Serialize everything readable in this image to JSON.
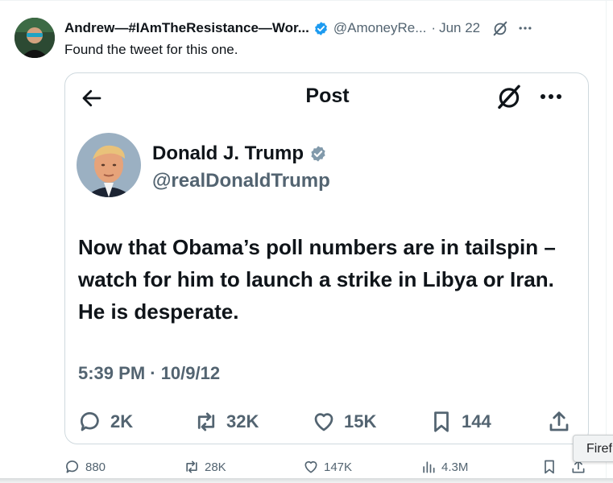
{
  "outer_tweet": {
    "author_name": "Andrew—#IAmTheResistance—Wor...",
    "handle": "@AmoneyRe...",
    "separator": "·",
    "date": "Jun 22",
    "text": "Found the tweet for this one.",
    "stats": {
      "replies": "880",
      "retweets": "28K",
      "likes": "147K",
      "views": "4.3M"
    }
  },
  "card": {
    "title": "Post",
    "author_name": "Donald J. Trump",
    "handle": "@realDonaldTrump",
    "text": "Now that Obama’s poll numbers are in tailspin – watch for him to launch a strike in Libya or Iran.  He is desperate.",
    "timestamp": "5:39 PM · 10/9/12",
    "stats": {
      "replies": "2K",
      "retweets": "32K",
      "likes": "15K",
      "bookmarks": "144"
    }
  },
  "tooltip": {
    "text": "Firef"
  },
  "colors": {
    "verified_blue": "#1d9bf0",
    "verified_gray": "#829aab",
    "secondary_text": "#536471",
    "primary_text": "#0f1419",
    "border": "#cfd9de"
  },
  "icons": [
    "back-arrow-icon",
    "grok-icon",
    "more-icon",
    "reply-icon",
    "retweet-icon",
    "like-icon",
    "bookmark-icon",
    "share-icon",
    "views-icon",
    "verified-badge-icon"
  ]
}
